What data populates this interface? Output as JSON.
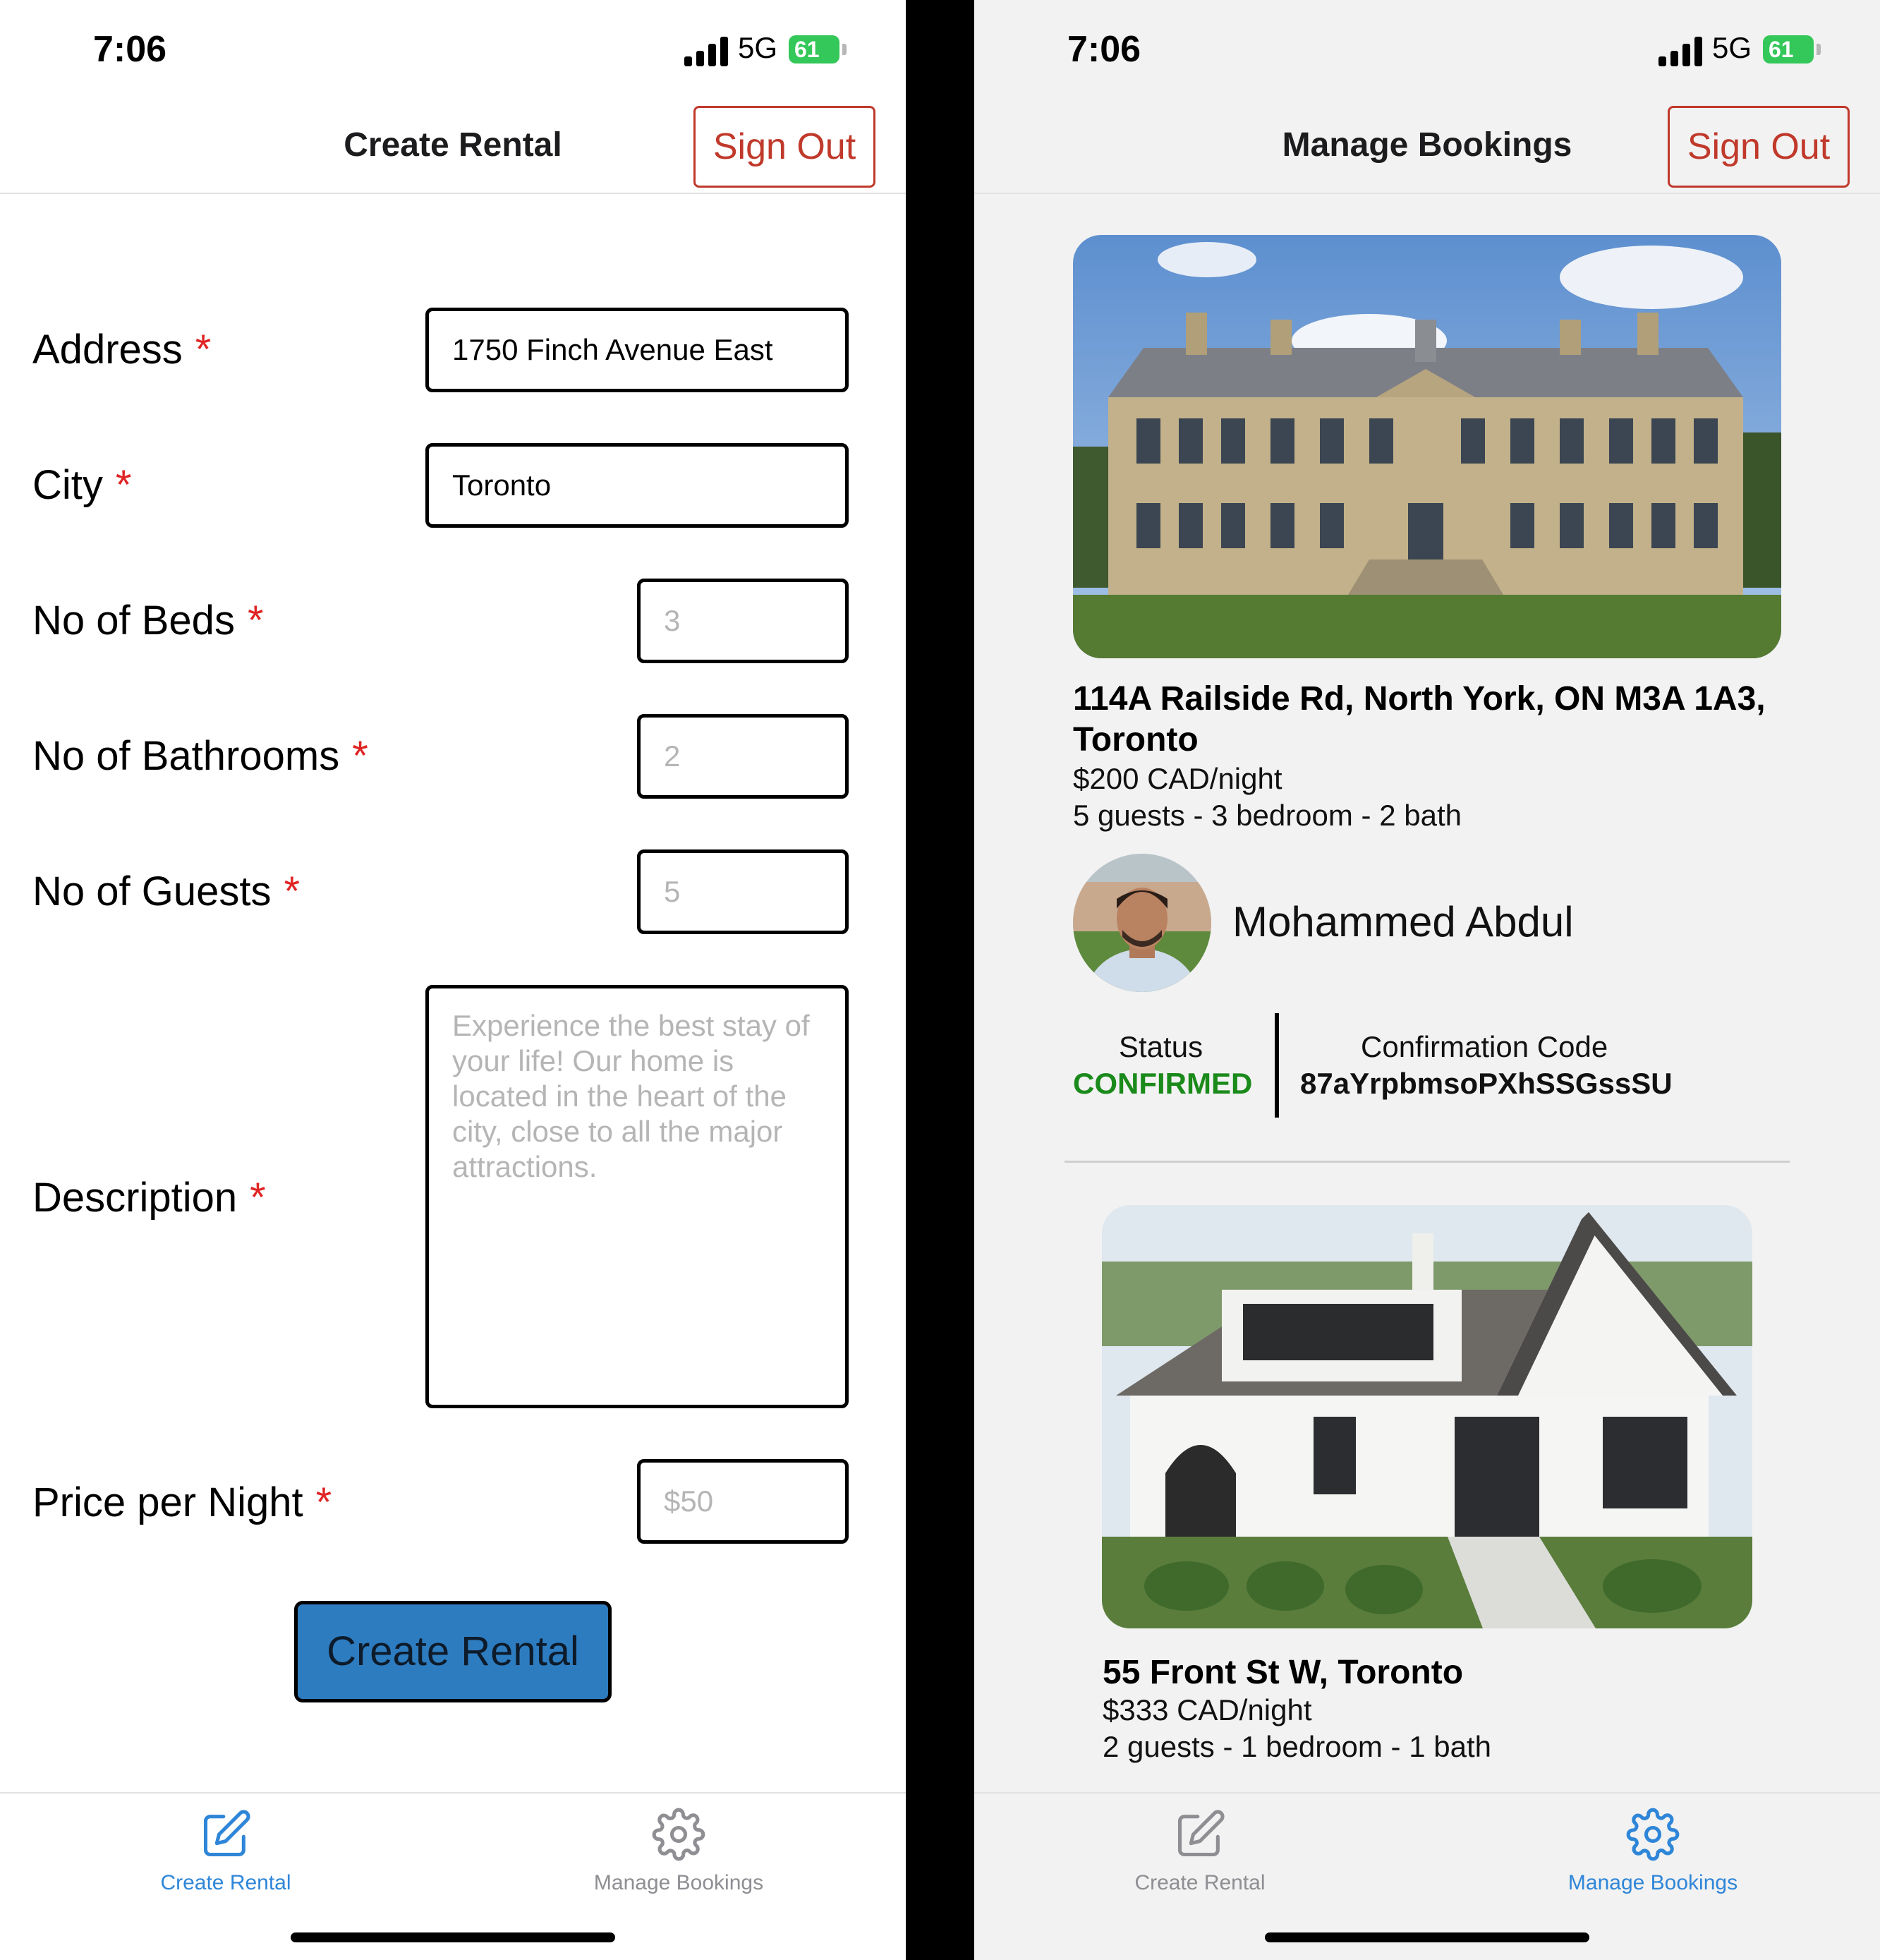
{
  "status_bar": {
    "time": "7:06",
    "network": "5G",
    "battery": "61"
  },
  "sign_out_label": "Sign Out",
  "create_screen": {
    "title": "Create Rental",
    "fields": {
      "address": {
        "label": "Address",
        "value": "1750 Finch Avenue East"
      },
      "city": {
        "label": "City",
        "value": "Toronto"
      },
      "beds": {
        "label": "No of Beds",
        "placeholder": "3"
      },
      "bathrooms": {
        "label": "No of Bathrooms",
        "placeholder": "2"
      },
      "guests": {
        "label": "No of Guests",
        "placeholder": "5"
      },
      "description": {
        "label": "Description",
        "placeholder": "Experience the best stay of your life! Our home is located in the heart of the city, close to all the major attractions."
      },
      "price": {
        "label": "Price per Night",
        "placeholder": "$50"
      }
    },
    "required_marker": "*",
    "submit_label": "Create Rental"
  },
  "bookings_screen": {
    "title": "Manage Bookings",
    "bookings": [
      {
        "address": "114A Railside Rd, North York, ON M3A 1A3, Toronto",
        "price": "$200 CAD/night",
        "details": "5 guests - 3 bedroom - 2 bath",
        "host_name": "Mohammed Abdul",
        "status_label": "Status",
        "status_value": "CONFIRMED",
        "code_label": "Confirmation Code",
        "code_value": "87aYrpbmsoPXhSSGssSU"
      },
      {
        "address": "55 Front St W, Toronto",
        "price": "$333 CAD/night",
        "details": "2 guests - 1 bedroom - 1 bath"
      }
    ]
  },
  "tabs": [
    {
      "label": "Create Rental",
      "icon": "edit-icon"
    },
    {
      "label": "Manage Bookings",
      "icon": "gear-icon"
    }
  ],
  "colors": {
    "accent": "#2f86d8",
    "danger": "#c0392b",
    "required": "#e02424",
    "confirmed": "#1a8a1a",
    "primary_button": "#2e7cc0",
    "battery": "#34c759"
  }
}
